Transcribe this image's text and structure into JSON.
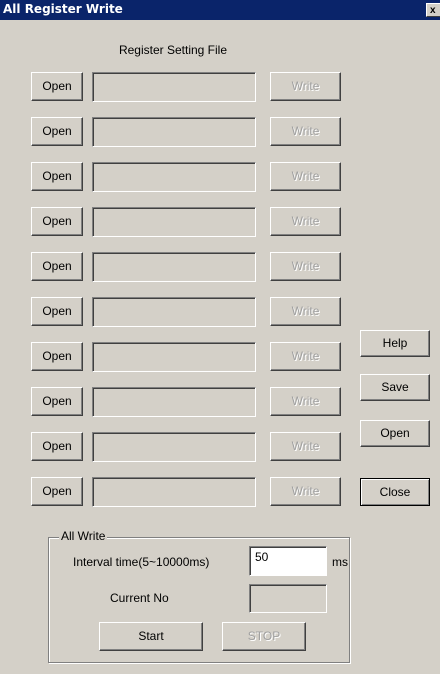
{
  "window": {
    "title": "All Register Write",
    "close_glyph": "x"
  },
  "header": {
    "label": "Register Setting File"
  },
  "rows": [
    {
      "open_label": "Open",
      "file_value": "",
      "write_label": "Write"
    },
    {
      "open_label": "Open",
      "file_value": "",
      "write_label": "Write"
    },
    {
      "open_label": "Open",
      "file_value": "",
      "write_label": "Write"
    },
    {
      "open_label": "Open",
      "file_value": "",
      "write_label": "Write"
    },
    {
      "open_label": "Open",
      "file_value": "",
      "write_label": "Write"
    },
    {
      "open_label": "Open",
      "file_value": "",
      "write_label": "Write"
    },
    {
      "open_label": "Open",
      "file_value": "",
      "write_label": "Write"
    },
    {
      "open_label": "Open",
      "file_value": "",
      "write_label": "Write"
    },
    {
      "open_label": "Open",
      "file_value": "",
      "write_label": "Write"
    },
    {
      "open_label": "Open",
      "file_value": "",
      "write_label": "Write"
    }
  ],
  "side_buttons": {
    "help": "Help",
    "save": "Save",
    "open": "Open",
    "close": "Close"
  },
  "all_write": {
    "group_title": "All Write",
    "interval_label": "Interval time(5~10000ms)",
    "interval_value": "50",
    "interval_unit": "ms",
    "current_no_label": "Current No",
    "current_no_value": "",
    "start_label": "Start",
    "stop_label": "STOP"
  },
  "colors": {
    "face": "#d4d0c8",
    "titlebar": "#0a246a",
    "disabled_text": "#a0a0a0"
  }
}
